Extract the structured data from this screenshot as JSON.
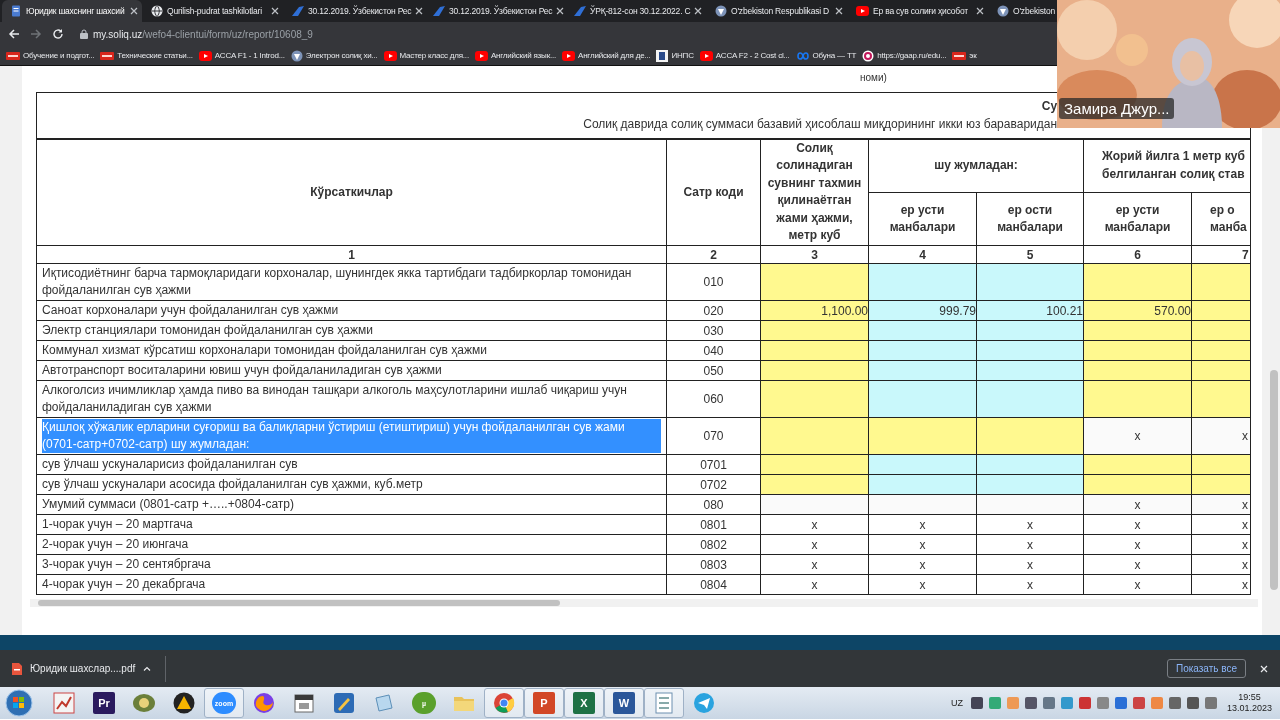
{
  "browser": {
    "tabs": [
      {
        "label": "Юридик шахснинг шахсий",
        "kind": "doc",
        "selected": true
      },
      {
        "label": "Qurilish-pudrat tashkilotlari",
        "kind": "globe",
        "selected": false
      },
      {
        "label": "30.12.2019. Ўзбекистон Рес",
        "kind": "swoosh",
        "selected": false
      },
      {
        "label": "30.12.2019. Ўзбекистон Рес",
        "kind": "swoosh",
        "selected": false
      },
      {
        "label": "ЎРҚ-812-сон 30.12.2022. С",
        "kind": "swoosh",
        "selected": false
      },
      {
        "label": "O'zbekiston Respublikasi D",
        "kind": "emblem",
        "selected": false
      },
      {
        "label": "Ер ва сув солиғи ҳисобот",
        "kind": "video",
        "selected": false
      },
      {
        "label": "O'zbekiston",
        "kind": "emblem",
        "selected": false
      }
    ],
    "address": {
      "host": "my.soliq.uz",
      "path": "/wefo4-clientui/form/uz/report/10608_9"
    },
    "bookmarks": [
      {
        "label": "Обучение и подгот...",
        "kind": "redlogo"
      },
      {
        "label": "Технические статьи...",
        "kind": "redlogo"
      },
      {
        "label": "ACCA F1 - 1 Introd...",
        "kind": "video"
      },
      {
        "label": "Электрон солиқ хи...",
        "kind": "emblem"
      },
      {
        "label": "Мастер класс для...",
        "kind": "video"
      },
      {
        "label": "Английский язык...",
        "kind": "video"
      },
      {
        "label": "Английский для де...",
        "kind": "video"
      },
      {
        "label": "ИНПС",
        "kind": "tile"
      },
      {
        "label": "ACCA F2 - 2 Cost cl...",
        "kind": "video"
      },
      {
        "label": "Обуна — ТТ",
        "kind": "loop"
      },
      {
        "label": "https://gaap.ru/edu...",
        "kind": "flower"
      },
      {
        "label": "эк",
        "kind": "redlogo"
      }
    ]
  },
  "report": {
    "top_note": "номи)",
    "title": "Су",
    "subtitle": "Солиқ даврида солиқ суммаси базавий ҳисоблаш миқдорининг икки юз бараваридан",
    "headers": {
      "indicator": "Кўрсаткичлар",
      "code": "Сатр коди",
      "volume": "Солиқ солинадиган сувнинг тахмин қилинаётган жами ҳажми, метр куб",
      "including": "шу жумладан:",
      "rate_lines": [
        "Жорий йилга 1 метр куб",
        "белгиланган солиқ став"
      ],
      "sub": [
        [
          "ер усти",
          "манбалари"
        ],
        [
          "ер ости",
          "манбалари"
        ],
        [
          "ер усти",
          "манбалари"
        ],
        [
          "ер о",
          "манба"
        ]
      ],
      "numbers": [
        "1",
        "2",
        "3",
        "4",
        "5",
        "6",
        "7"
      ]
    },
    "rows": [
      {
        "label": "Иқтисодиётнинг барча тармоқларидаги корхоналар, шунингдек якка тартибдаги тадбиркорлар томонидан фойдаланилган сув ҳажми",
        "code": "010",
        "selected": false,
        "cells": [
          {
            "kind": "input",
            "color": "#fff98f"
          },
          {
            "kind": "input",
            "color": "#c9f8fb"
          },
          {
            "kind": "input",
            "color": "#c9f8fb"
          },
          {
            "kind": "input",
            "color": "#fff98f"
          },
          {
            "kind": "input",
            "color": "#fff98f"
          }
        ]
      },
      {
        "label": "Саноат корхоналари учун фойдаланилган сув ҳажми",
        "code": "020",
        "selected": false,
        "cells": [
          {
            "kind": "number",
            "value": "1,100.00",
            "color": "#fff98f"
          },
          {
            "kind": "number",
            "value": "999.79",
            "color": "#c9f8fb"
          },
          {
            "kind": "number",
            "value": "100.21",
            "color": "#c9f8fb"
          },
          {
            "kind": "number",
            "value": "570.00",
            "color": "#fff98f"
          },
          {
            "kind": "input",
            "color": "#fff98f"
          }
        ]
      },
      {
        "label": "Электр станциялари томонидан фойдаланилган сув ҳажми",
        "code": "030",
        "selected": false,
        "cells": [
          {
            "kind": "input",
            "color": "#fff98f"
          },
          {
            "kind": "input",
            "color": "#c9f8fb"
          },
          {
            "kind": "input",
            "color": "#c9f8fb"
          },
          {
            "kind": "input",
            "color": "#fff98f"
          },
          {
            "kind": "input",
            "color": "#fff98f"
          }
        ]
      },
      {
        "label": "Коммунал хизмат кўрсатиш корхоналари томонидан фойдаланилган сув ҳажми",
        "code": "040",
        "selected": false,
        "cells": [
          {
            "kind": "input",
            "color": "#fff98f"
          },
          {
            "kind": "input",
            "color": "#c9f8fb"
          },
          {
            "kind": "input",
            "color": "#c9f8fb"
          },
          {
            "kind": "input",
            "color": "#fff98f"
          },
          {
            "kind": "input",
            "color": "#fff98f"
          }
        ]
      },
      {
        "label": "Автотранспорт воситаларини ювиш учун фойдаланиладиган сув ҳажми",
        "code": "050",
        "selected": false,
        "cells": [
          {
            "kind": "input",
            "color": "#fff98f"
          },
          {
            "kind": "input",
            "color": "#c9f8fb"
          },
          {
            "kind": "input",
            "color": "#c9f8fb"
          },
          {
            "kind": "input",
            "color": "#fff98f"
          },
          {
            "kind": "input",
            "color": "#fff98f"
          }
        ]
      },
      {
        "label": "Алкоголсиз ичимликлар ҳамда пиво ва винодан ташқари алкоголь маҳсулотларини ишлаб чиқариш учун фойдаланиладиган сув ҳажми",
        "code": "060",
        "selected": false,
        "cells": [
          {
            "kind": "input",
            "color": "#fff98f"
          },
          {
            "kind": "input",
            "color": "#c9f8fb"
          },
          {
            "kind": "input",
            "color": "#c9f8fb"
          },
          {
            "kind": "input",
            "color": "#fff98f"
          },
          {
            "kind": "input",
            "color": "#fff98f"
          }
        ]
      },
      {
        "label": "Қишлоқ хўжалик ерларини суғориш ва балиқларни ўстириш (етиштириш) учун фойдаланилган сув жами (0701-сатр+0702-сатр) шу жумладан:",
        "code": "070",
        "selected": true,
        "cells": [
          {
            "kind": "input",
            "color": "#fff98f"
          },
          {
            "kind": "input",
            "color": "#fff98f"
          },
          {
            "kind": "input",
            "color": "#fff98f"
          },
          {
            "kind": "cross",
            "value": "x",
            "color": "#fafafa"
          },
          {
            "kind": "cross",
            "value": "x",
            "color": "#fafafa"
          }
        ]
      },
      {
        "label": "сув ўлчаш ускуналарисиз фойдаланилган сув",
        "code": "0701",
        "selected": false,
        "cells": [
          {
            "kind": "input",
            "color": "#fff98f"
          },
          {
            "kind": "input",
            "color": "#c9f8fb"
          },
          {
            "kind": "input",
            "color": "#c9f8fb"
          },
          {
            "kind": "input",
            "color": "#fff98f"
          },
          {
            "kind": "input",
            "color": "#fff98f"
          }
        ]
      },
      {
        "label": "сув ўлчаш ускуналари асосида фойдаланилган сув ҳажми, куб.метр",
        "code": "0702",
        "selected": false,
        "cells": [
          {
            "kind": "input",
            "color": "#fff98f"
          },
          {
            "kind": "input",
            "color": "#c9f8fb"
          },
          {
            "kind": "input",
            "color": "#c9f8fb"
          },
          {
            "kind": "input",
            "color": "#fff98f"
          },
          {
            "kind": "input",
            "color": "#fff98f"
          }
        ]
      },
      {
        "label": "Умумий суммаси (0801-сатр +…..+0804-сатр)",
        "code": "080",
        "selected": false,
        "cells": [
          {
            "kind": "blank",
            "color": "#fafafa"
          },
          {
            "kind": "blank",
            "color": "#fafafa"
          },
          {
            "kind": "blank",
            "color": "#fafafa"
          },
          {
            "kind": "cross",
            "value": "x",
            "color": "#fafafa"
          },
          {
            "kind": "cross",
            "value": "x",
            "color": "#fafafa"
          }
        ]
      },
      {
        "label": "1-чорак учун – 20 мартгача",
        "code": "0801",
        "selected": false,
        "cells": [
          {
            "kind": "cross",
            "value": "x",
            "color": "#ffffff"
          },
          {
            "kind": "cross",
            "value": "x",
            "color": "#ffffff"
          },
          {
            "kind": "cross",
            "value": "x",
            "color": "#ffffff"
          },
          {
            "kind": "cross",
            "value": "x",
            "color": "#ffffff"
          },
          {
            "kind": "cross",
            "value": "x",
            "color": "#ffffff"
          }
        ]
      },
      {
        "label": "2-чорак учун – 20 июнгача",
        "code": "0802",
        "selected": false,
        "cells": [
          {
            "kind": "cross",
            "value": "x",
            "color": "#ffffff"
          },
          {
            "kind": "cross",
            "value": "x",
            "color": "#ffffff"
          },
          {
            "kind": "cross",
            "value": "x",
            "color": "#ffffff"
          },
          {
            "kind": "cross",
            "value": "x",
            "color": "#ffffff"
          },
          {
            "kind": "cross",
            "value": "x",
            "color": "#ffffff"
          }
        ]
      },
      {
        "label": "3-чорак учун – 20 сентябргача",
        "code": "0803",
        "selected": false,
        "cells": [
          {
            "kind": "cross",
            "value": "x",
            "color": "#ffffff"
          },
          {
            "kind": "cross",
            "value": "x",
            "color": "#ffffff"
          },
          {
            "kind": "cross",
            "value": "x",
            "color": "#ffffff"
          },
          {
            "kind": "cross",
            "value": "x",
            "color": "#ffffff"
          },
          {
            "kind": "cross",
            "value": "x",
            "color": "#ffffff"
          }
        ]
      },
      {
        "label": "4-чорак учун – 20 декабргача",
        "code": "0804",
        "selected": false,
        "cells": [
          {
            "kind": "cross",
            "value": "x",
            "color": "#ffffff"
          },
          {
            "kind": "cross",
            "value": "x",
            "color": "#ffffff"
          },
          {
            "kind": "cross",
            "value": "x",
            "color": "#ffffff"
          },
          {
            "kind": "cross",
            "value": "x",
            "color": "#ffffff"
          },
          {
            "kind": "cross",
            "value": "x",
            "color": "#ffffff"
          }
        ]
      }
    ]
  },
  "video_tile": {
    "name": "Замира Джур...",
    "kind": "picture"
  },
  "downloads": {
    "file": "Юридик шахслар....pdf",
    "show_all": "Показать все"
  },
  "taskbar": {
    "apps": [
      {
        "kind": "chart",
        "running": false
      },
      {
        "kind": "purple-tile",
        "glyph": "Pr",
        "running": false
      },
      {
        "kind": "emblem",
        "running": false
      },
      {
        "kind": "triangle",
        "running": false
      },
      {
        "kind": "blue-round",
        "glyph": "zoom",
        "running": true
      },
      {
        "kind": "globe",
        "running": false
      },
      {
        "kind": "calendar",
        "running": false
      },
      {
        "kind": "pen",
        "running": false
      },
      {
        "kind": "paper",
        "running": false
      },
      {
        "kind": "green-round",
        "glyph": "µ",
        "running": false
      },
      {
        "kind": "folder",
        "running": false
      },
      {
        "kind": "browser",
        "running": true
      },
      {
        "kind": "orange-tile",
        "glyph": "P",
        "running": true
      },
      {
        "kind": "green-tile",
        "glyph": "X",
        "running": true
      },
      {
        "kind": "blue-tile",
        "glyph": "W",
        "running": true
      },
      {
        "kind": "document",
        "running": true
      },
      {
        "kind": "plane",
        "running": false
      }
    ],
    "language": "UZ",
    "time": "19:55",
    "date": "13.01.2023"
  }
}
